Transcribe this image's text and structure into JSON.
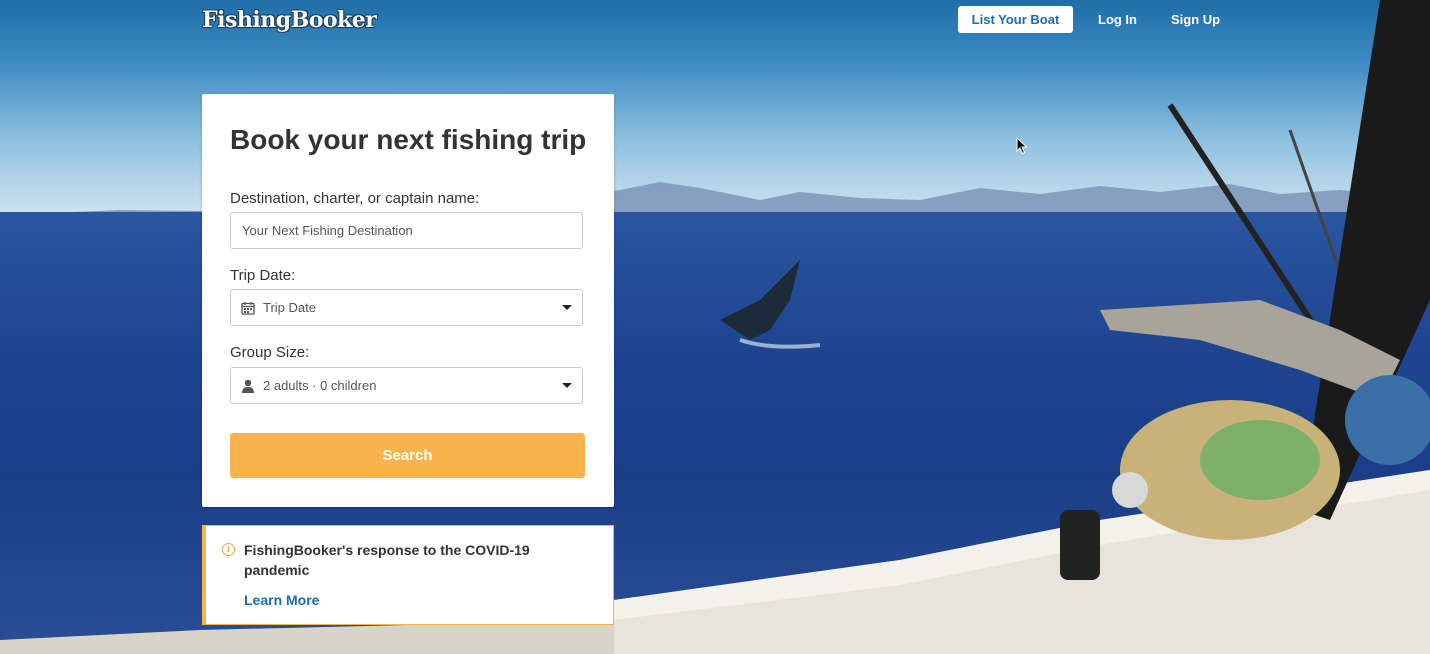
{
  "header": {
    "logo": "FishingBooker",
    "list_boat": "List Your Boat",
    "login": "Log In",
    "signup": "Sign Up"
  },
  "search_card": {
    "title": "Book your next fishing trip",
    "destination_label": "Destination, charter, or captain name:",
    "destination_placeholder": "Your Next Fishing Destination",
    "date_label": "Trip Date:",
    "date_value": "Trip Date",
    "group_label": "Group Size:",
    "group_value": "2 adults · 0 children",
    "search_button": "Search"
  },
  "notice": {
    "text": "FishingBooker's response to the COVID-19 pandemic",
    "link": "Learn More"
  },
  "colors": {
    "accent_orange": "#f8b34c",
    "link_blue": "#1a6cb0"
  },
  "icons": [
    "calendar-icon",
    "person-icon",
    "chevron-down-icon",
    "info-icon",
    "cursor-icon"
  ]
}
